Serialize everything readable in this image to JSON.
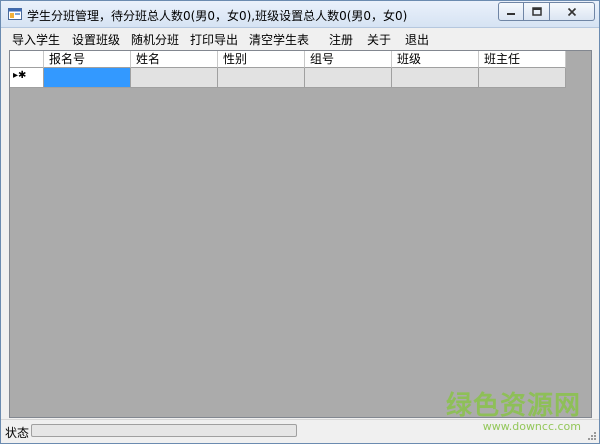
{
  "window": {
    "title": "学生分班管理，待分班总人数0(男0，女0),班级设置总人数0(男0，女0)"
  },
  "menu": {
    "items": [
      "导入学生",
      "设置班级",
      "随机分班",
      "打印导出",
      "清空学生表",
      "注册",
      "关于",
      "退出"
    ]
  },
  "grid": {
    "columns": [
      "报名号",
      "姓名",
      "性别",
      "组号",
      "班级",
      "班主任"
    ],
    "new_row_glyph": "▸✱"
  },
  "status": {
    "label": "状态",
    "progress": 0
  },
  "watermark": {
    "logo": "绿色资源网",
    "url": "www.downcc.com"
  },
  "colors": {
    "selection": "#3399ff",
    "grid_background": "#ababab",
    "watermark": "#8ac34a"
  }
}
